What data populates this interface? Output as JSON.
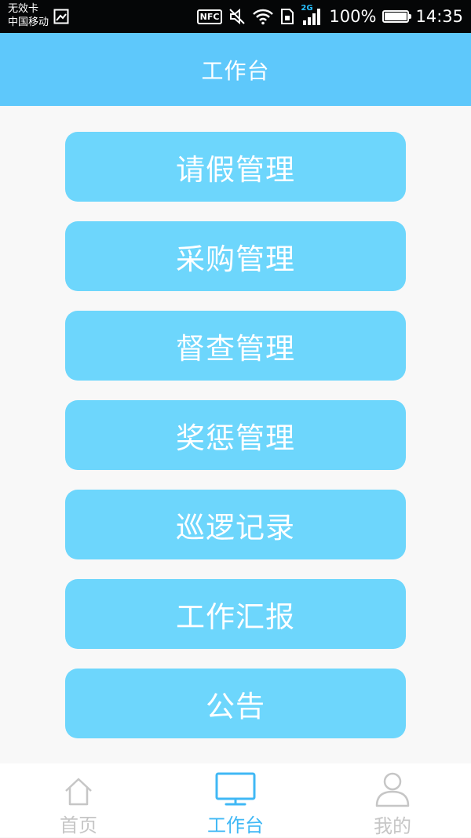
{
  "status_bar": {
    "carrier_line1": "无效卡",
    "carrier_line2": "中国移动",
    "nfc_label": "NFC",
    "network_type": "2G",
    "battery": "100%",
    "time": "14:35"
  },
  "header": {
    "title": "工作台"
  },
  "menu": {
    "items": [
      {
        "label": "请假管理"
      },
      {
        "label": "采购管理"
      },
      {
        "label": "督查管理"
      },
      {
        "label": "奖惩管理"
      },
      {
        "label": "巡逻记录"
      },
      {
        "label": "工作汇报"
      },
      {
        "label": "公告"
      }
    ]
  },
  "bottom_nav": {
    "items": [
      {
        "label": "首页",
        "icon": "home-icon"
      },
      {
        "label": "工作台",
        "icon": "monitor-icon"
      },
      {
        "label": "我的",
        "icon": "user-icon"
      }
    ],
    "active_index": 1
  },
  "colors": {
    "header_bg": "#5ec8fb",
    "button_bg": "#6dd6fc",
    "active_nav": "#40b8f5",
    "inactive_nav": "#c6c6c6"
  }
}
